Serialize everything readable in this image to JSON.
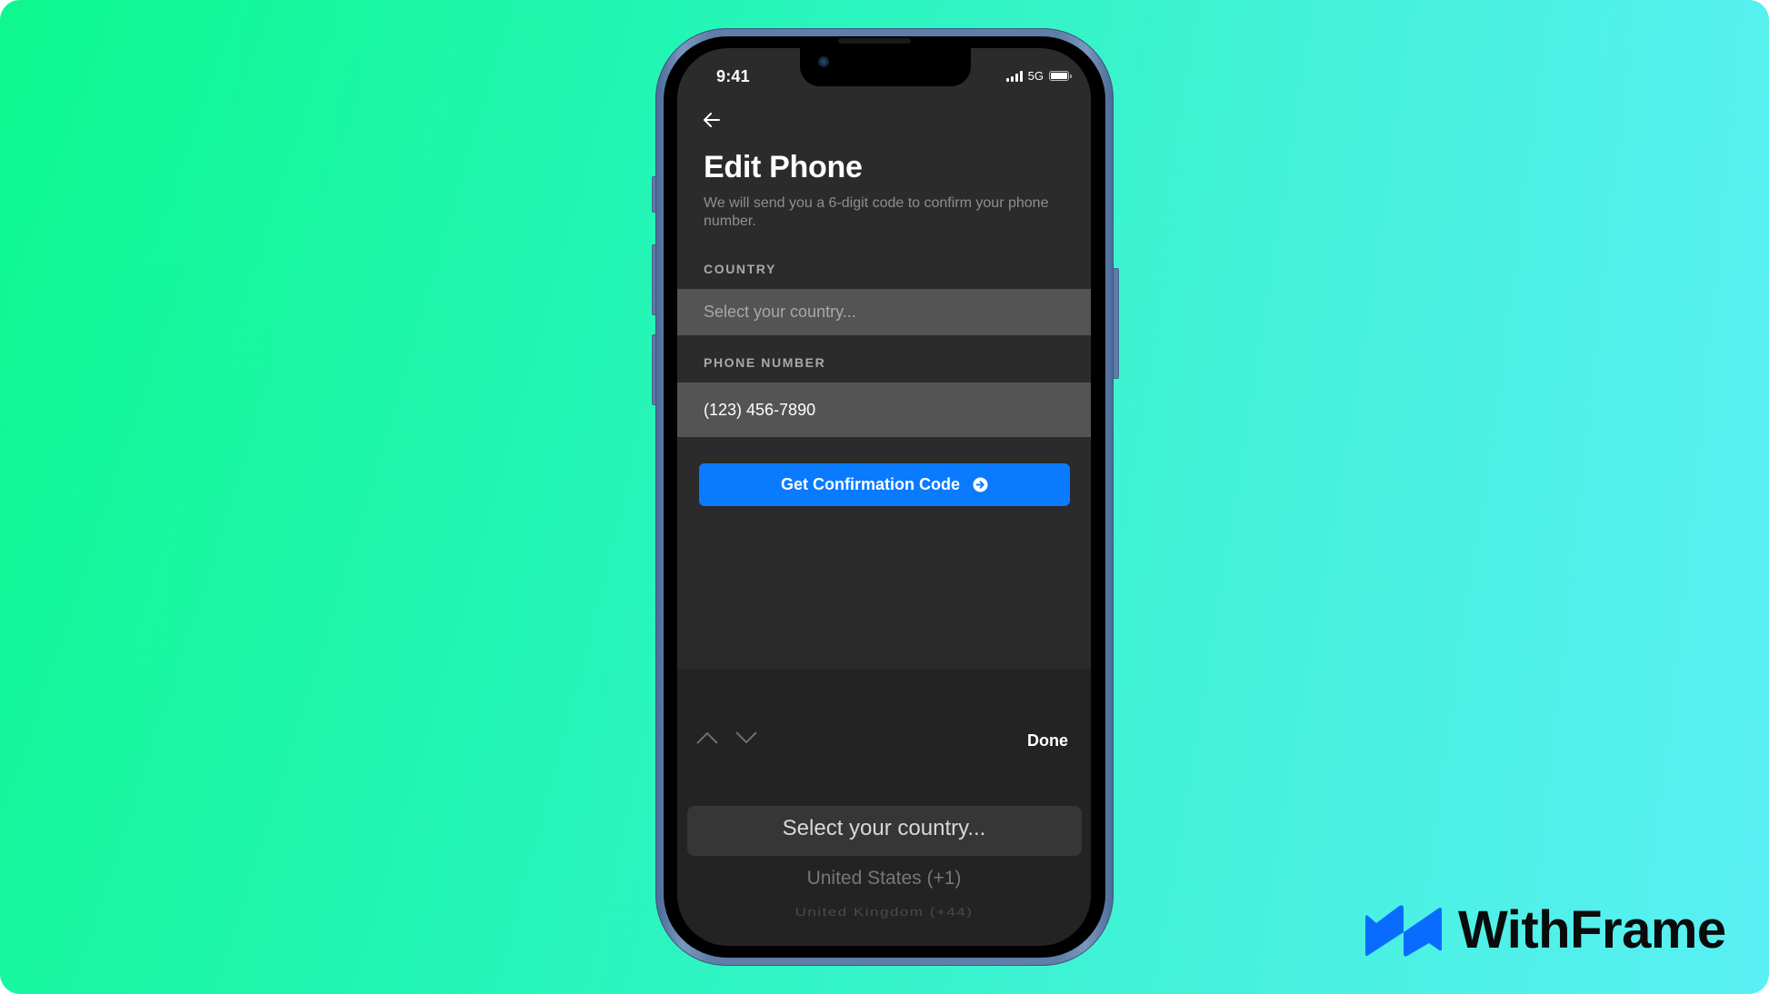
{
  "status_bar": {
    "time": "9:41",
    "network": "5G",
    "signal_icon": "signal-bars-icon",
    "battery_icon": "battery-icon"
  },
  "header": {
    "back_icon": "arrow-left-icon",
    "title": "Edit Phone",
    "description": "We will send you a 6-digit code to confirm your phone number."
  },
  "form": {
    "country": {
      "label": "COUNTRY",
      "value": "",
      "placeholder": "Select your country..."
    },
    "phone": {
      "label": "PHONE NUMBER",
      "value": "(123) 456-7890"
    },
    "submit": {
      "label": "Get Confirmation Code",
      "icon": "arrow-right-circle-icon"
    }
  },
  "keyboard_toolbar": {
    "prev_icon": "chevron-up-icon",
    "next_icon": "chevron-down-icon",
    "done_label": "Done"
  },
  "picker": {
    "selected": "Select your country...",
    "options": [
      "United States (+1)",
      "United Kingdom (+44)"
    ]
  },
  "brand": {
    "name": "WithFrame",
    "logo_color": "#0a6cff"
  },
  "colors": {
    "accent": "#0a7aff",
    "screen_bg": "#2b2b2b",
    "field_bg": "#545454",
    "keyboard_bg": "#232323",
    "background_start": "#0df88e",
    "background_end": "#5eeff8"
  }
}
